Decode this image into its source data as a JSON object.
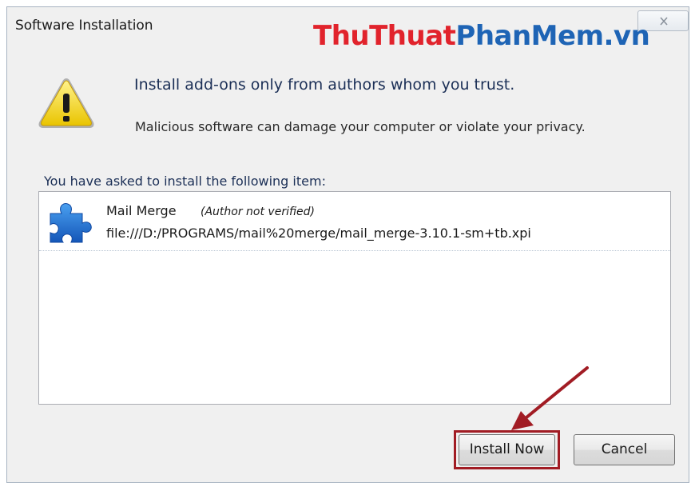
{
  "window": {
    "title": "Software Installation",
    "close_icon": "close-icon"
  },
  "watermark": {
    "part1": "ThuThuat",
    "part2": "PhanMem",
    "part3": ".vn"
  },
  "warning": {
    "icon": "warning-icon",
    "headline": "Install add-ons only from authors whom you trust.",
    "detail": "Malicious software can damage your computer or violate your privacy."
  },
  "list_caption": "You have asked to install the following item:",
  "items": [
    {
      "icon": "puzzle-piece-icon",
      "name": "Mail Merge",
      "author_note": "(Author not verified)",
      "path": "file:///D:/PROGRAMS/mail%20merge/mail_merge-3.10.1-sm+tb.xpi"
    }
  ],
  "buttons": {
    "install_label": "Install Now",
    "cancel_label": "Cancel"
  },
  "colors": {
    "highlight": "#a11c24",
    "watermark_red": "#e1232c",
    "watermark_blue": "#1e64b5"
  }
}
